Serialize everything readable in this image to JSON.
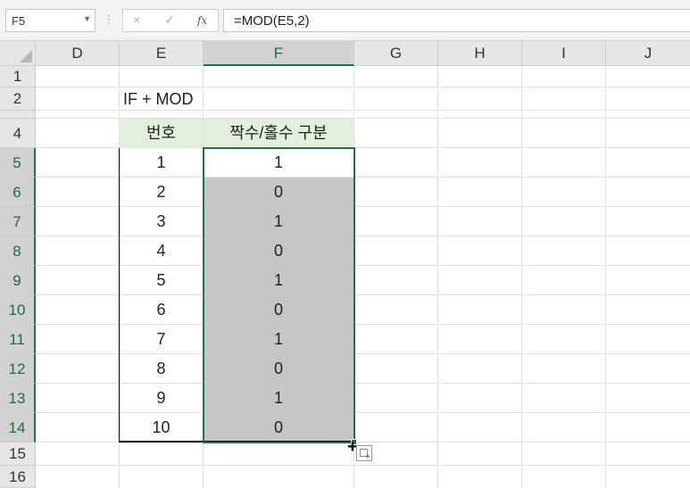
{
  "formula_bar": {
    "name_box": "F5",
    "name_box_arrow_icon": "chevron-down-icon",
    "cancel_icon": "×",
    "enter_icon": "✓",
    "function_label": "fx",
    "formula": "=MOD(E5,2)"
  },
  "columns": [
    "D",
    "E",
    "F",
    "G",
    "H",
    "I",
    "J"
  ],
  "rows": [
    "1",
    "2",
    "4",
    "5",
    "6",
    "7",
    "8",
    "9",
    "10",
    "11",
    "12",
    "13",
    "14",
    "15",
    "16"
  ],
  "active_cell": "F5",
  "selection": "F5:F14",
  "sheet": {
    "title_cell": {
      "ref": "E2",
      "text": "IF + MOD"
    },
    "table": {
      "headers": [
        "번호",
        "짝수/홀수 구분"
      ],
      "rows": [
        [
          "1",
          "1"
        ],
        [
          "2",
          "0"
        ],
        [
          "3",
          "1"
        ],
        [
          "4",
          "0"
        ],
        [
          "5",
          "1"
        ],
        [
          "6",
          "0"
        ],
        [
          "7",
          "1"
        ],
        [
          "8",
          "0"
        ],
        [
          "9",
          "1"
        ],
        [
          "10",
          "0"
        ]
      ]
    }
  },
  "colors": {
    "header_fill": "#e2efda",
    "selection_fill": "#c6c6c6",
    "selection_border": "#217346"
  }
}
